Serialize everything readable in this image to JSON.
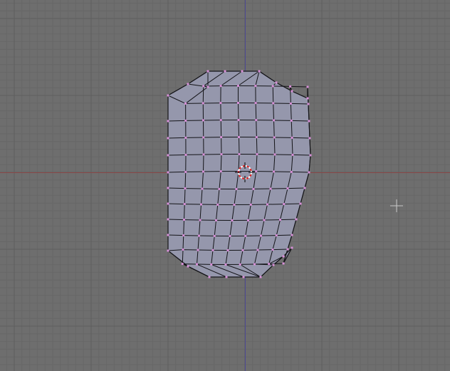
{
  "viewport": {
    "view": "top-orthographic",
    "mode": "edit-mesh",
    "grid": true
  },
  "colors": {
    "background": "#6e6e6e",
    "grid_minor": "#676767",
    "grid_major": "#5e5e5e",
    "x_axis": "#8a4848",
    "y_axis": "#4e4a92",
    "mesh_face": "#9597ac",
    "mesh_edge": "#141418",
    "vertex": "#d890d8",
    "cursor_ring_red": "#e02020",
    "cursor_ring_white": "#ffffff",
    "widget": "#c8c8c8"
  },
  "icons": {
    "cursor": "3d-cursor-icon",
    "transform_widget": "crosshair-icon"
  }
}
